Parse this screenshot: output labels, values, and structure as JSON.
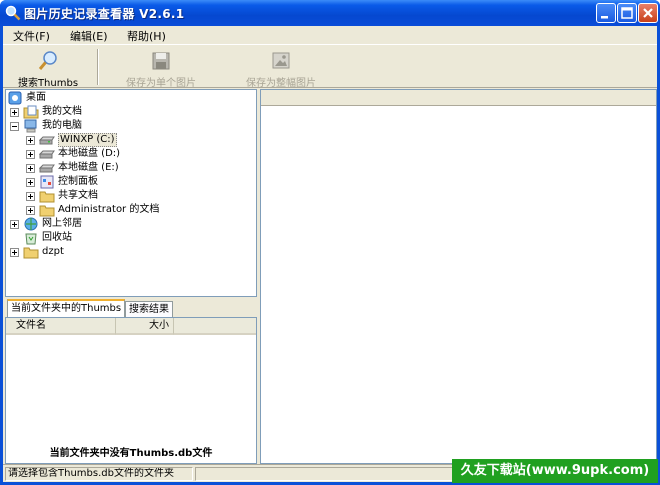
{
  "window": {
    "title": "图片历史记录查看器 V2.6.1",
    "icon": "magnifier-app-icon"
  },
  "menu": [
    {
      "label": "文件(F)"
    },
    {
      "label": "编辑(E)"
    },
    {
      "label": "帮助(H)"
    }
  ],
  "toolbar": {
    "search_label": "搜索Thumbs",
    "save_single_label": "保存为单个图片",
    "save_whole_label": "保存为整幅图片"
  },
  "tree": [
    {
      "label": "桌面",
      "icon": "desktop-icon",
      "expander": "minus"
    },
    {
      "label": "我的文档",
      "icon": "my-documents-icon",
      "expander": "plus"
    },
    {
      "label": "我的电脑",
      "icon": "my-computer-icon",
      "expander": "minus"
    },
    {
      "label": "WINXP (C:)",
      "icon": "drive-icon",
      "expander": "plus",
      "selected": true
    },
    {
      "label": "本地磁盘 (D:)",
      "icon": "drive-icon",
      "expander": "plus"
    },
    {
      "label": "本地磁盘 (E:)",
      "icon": "drive-icon",
      "expander": "plus"
    },
    {
      "label": "控制面板",
      "icon": "control-panel-icon",
      "expander": "plus"
    },
    {
      "label": "共享文档",
      "icon": "folder-icon",
      "expander": "plus"
    },
    {
      "label": "Administrator 的文档",
      "icon": "folder-icon",
      "expander": "plus"
    },
    {
      "label": "网上邻居",
      "icon": "network-icon",
      "expander": "plus"
    },
    {
      "label": "回收站",
      "icon": "recycle-bin-icon",
      "expander": "none"
    },
    {
      "label": "dzpt",
      "icon": "folder-icon",
      "expander": "plus"
    }
  ],
  "tabs": [
    {
      "label": "当前文件夹中的Thumbs",
      "active": true
    },
    {
      "label": "搜索结果",
      "active": false
    }
  ],
  "list": {
    "col_name": "文件名",
    "col_size": "大小",
    "empty_message": "当前文件夹中没有Thumbs.db文件"
  },
  "status": {
    "text": "请选择包含Thumbs.db文件的文件夹"
  },
  "watermark": "久友下载站(www.9upk.com)"
}
